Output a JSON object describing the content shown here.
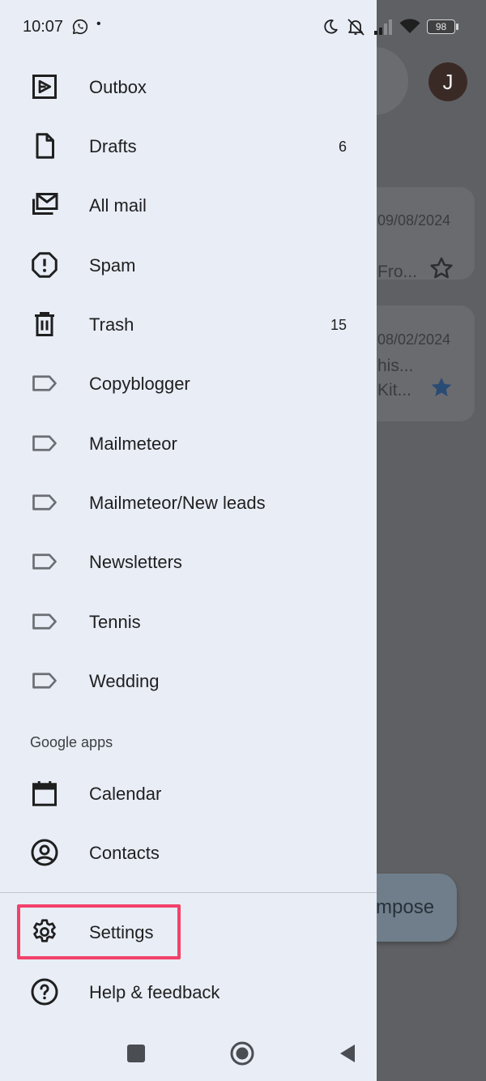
{
  "status_bar": {
    "time": "10:07",
    "battery": "98",
    "icons": [
      "whatsapp-icon",
      "moon-icon",
      "mute-icon",
      "signal-icon",
      "wifi-icon",
      "battery-icon"
    ]
  },
  "background": {
    "avatar_initial": "J",
    "emails": [
      {
        "date": "09/08/2024",
        "snippet": "Fro...",
        "starred": false
      },
      {
        "date": "08/02/2024",
        "snippet_line1": "his...",
        "snippet_line2": "Kit...",
        "starred": true
      }
    ],
    "compose_label": "mpose"
  },
  "drawer": {
    "items": [
      {
        "label": "Outbox",
        "icon": "outbox-icon",
        "count": ""
      },
      {
        "label": "Drafts",
        "icon": "drafts-icon",
        "count": "6"
      },
      {
        "label": "All mail",
        "icon": "all-mail-icon",
        "count": ""
      },
      {
        "label": "Spam",
        "icon": "spam-icon",
        "count": ""
      },
      {
        "label": "Trash",
        "icon": "trash-icon",
        "count": "15"
      },
      {
        "label": "Copyblogger",
        "icon": "label-icon",
        "count": ""
      },
      {
        "label": "Mailmeteor",
        "icon": "label-icon",
        "count": ""
      },
      {
        "label": "Mailmeteor/New leads",
        "icon": "label-icon",
        "count": ""
      },
      {
        "label": "Newsletters",
        "icon": "label-icon",
        "count": ""
      },
      {
        "label": "Tennis",
        "icon": "label-icon",
        "count": ""
      },
      {
        "label": "Wedding",
        "icon": "label-icon",
        "count": ""
      }
    ],
    "google_apps_header": "Google apps",
    "apps": [
      {
        "label": "Calendar",
        "icon": "calendar-icon"
      },
      {
        "label": "Contacts",
        "icon": "contacts-icon"
      }
    ],
    "footer": [
      {
        "label": "Settings",
        "icon": "gear-icon"
      },
      {
        "label": "Help & feedback",
        "icon": "help-icon"
      }
    ]
  },
  "colors": {
    "drawer_bg": "#e8edf6",
    "scrim": "#5f6064",
    "highlight": "#f2426a",
    "star_filled": "#2a4c74"
  }
}
